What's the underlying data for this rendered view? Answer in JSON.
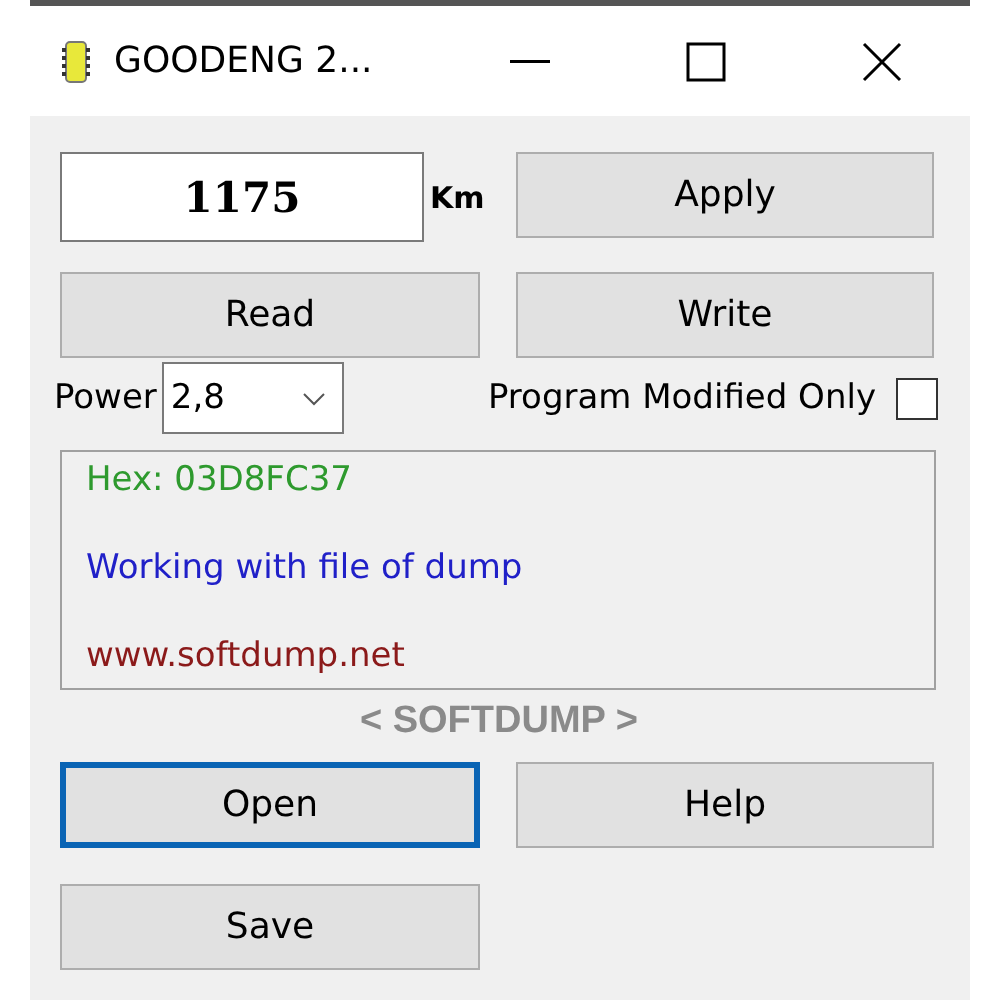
{
  "window": {
    "title": "GOODENG 2..."
  },
  "distance": {
    "value": "1175",
    "unit": "Km"
  },
  "top_buttons": [
    {
      "label": "Apply",
      "focused": false
    }
  ],
  "action_buttons": [
    {
      "label": "Read",
      "focused": false
    },
    {
      "label": "Write",
      "focused": false
    }
  ],
  "power": {
    "label": "Power",
    "value": "2,8"
  },
  "program_modified_only": {
    "label": "Program Modified Only",
    "checked": false
  },
  "log": [
    {
      "text": "Hex: 03D8FC37",
      "color": "#2e9a2e"
    },
    {
      "text": "Working with file of dump",
      "color": "#2020c8"
    },
    {
      "text": "www.softdump.net",
      "color": "#8b1a1a"
    }
  ],
  "brand": "< SOFTDUMP >",
  "bottom_buttons": [
    {
      "label": "Open",
      "focused": true
    },
    {
      "label": "Help",
      "focused": false
    },
    {
      "label": "Save",
      "focused": false
    }
  ]
}
